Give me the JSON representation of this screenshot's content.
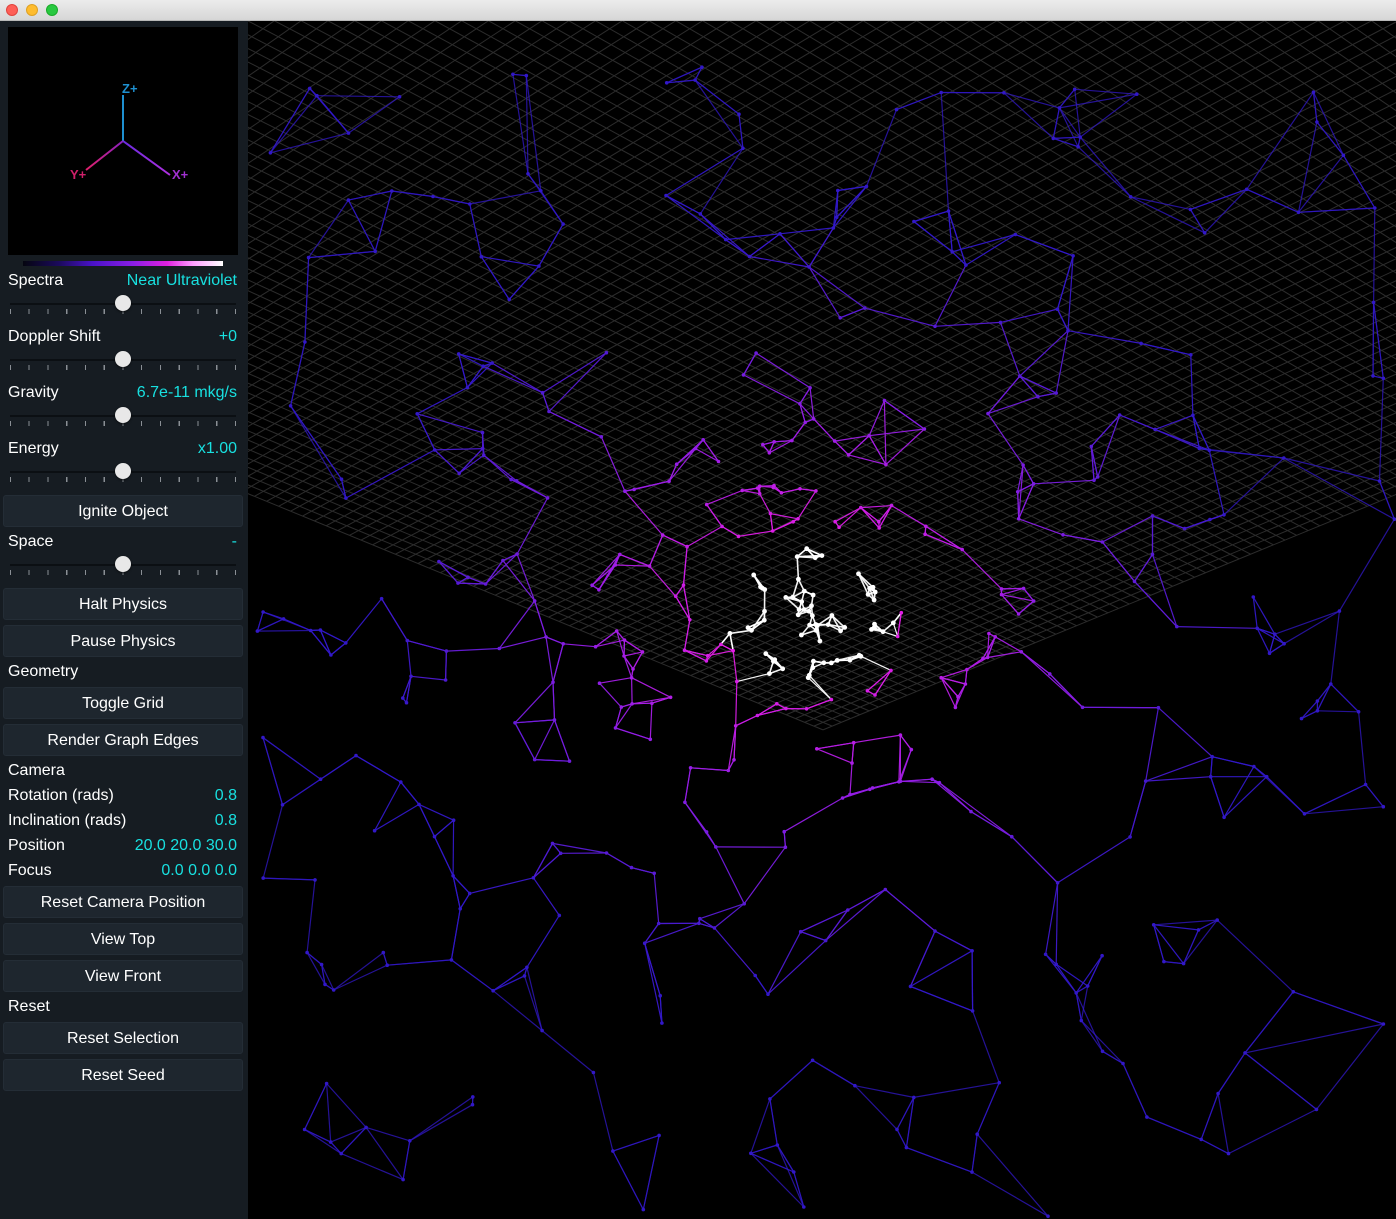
{
  "window": {
    "title": ""
  },
  "axes": {
    "z_label": "Z+",
    "x_label": "X+",
    "y_label": "Y+"
  },
  "controls": {
    "spectra": {
      "label": "Spectra",
      "value": "Near Ultraviolet",
      "level": 0.5
    },
    "doppler": {
      "label": "Doppler Shift",
      "value": "+0",
      "level": 0.5
    },
    "gravity": {
      "label": "Gravity",
      "value": "6.7e-11 mkg/s",
      "level": 0.5
    },
    "energy": {
      "label": "Energy",
      "value": "x1.00",
      "level": 0.5
    },
    "ignite_button": "Ignite Object",
    "space": {
      "label": "Space",
      "value": "-",
      "level": 0.5
    },
    "halt_button": "Halt Physics",
    "pause_button": "Pause Physics"
  },
  "geometry": {
    "heading": "Geometry",
    "toggle_grid_button": "Toggle Grid",
    "render_edges_button": "Render Graph Edges"
  },
  "camera": {
    "heading": "Camera",
    "rotation": {
      "label": "Rotation (rads)",
      "value": "0.8"
    },
    "inclination": {
      "label": "Inclination (rads)",
      "value": "0.8"
    },
    "position": {
      "label": "Position",
      "value": "20.0 20.0 30.0"
    },
    "focus": {
      "label": "Focus",
      "value": "0.0 0.0 0.0"
    },
    "reset_position_button": "Reset Camera Position",
    "view_top_button": "View Top",
    "view_front_button": "View Front"
  },
  "reset": {
    "heading": "Reset",
    "reset_selection_button": "Reset Selection",
    "reset_seed_button": "Reset Seed"
  },
  "colors": {
    "accent_value": "#18e0e0",
    "sidebar_bg": "#161c22",
    "button_bg": "#1e262e",
    "edge_outer": "#3218c8",
    "edge_mid": "#8c1ee6",
    "edge_inner": "#e61ee6",
    "edge_core": "#ffffff",
    "axis_z": "#1e90d0",
    "axis_x": "#a030d0",
    "axis_y": "#d0206a"
  }
}
